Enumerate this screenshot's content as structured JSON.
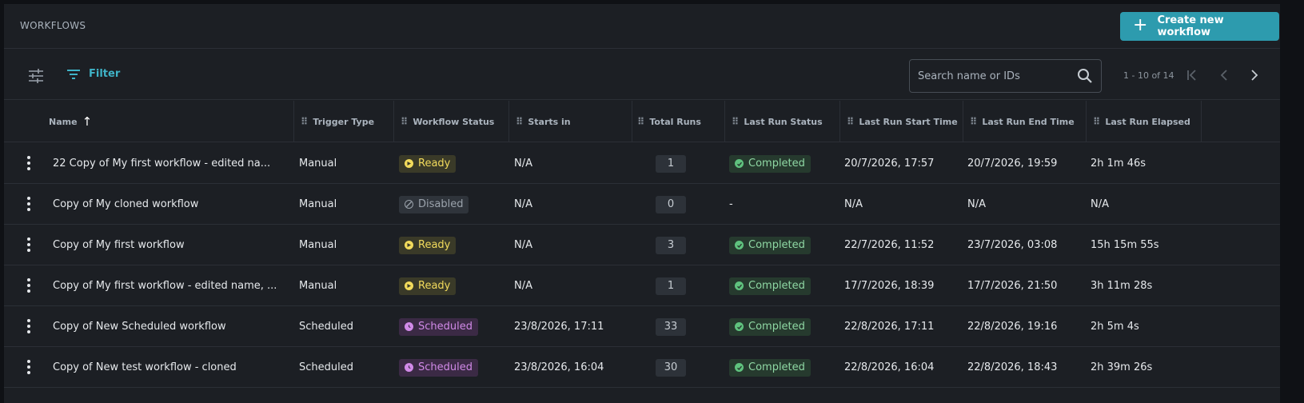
{
  "header": {
    "title": "WORKFLOWS",
    "create_label": "Create new workflow"
  },
  "toolbar": {
    "filter_label": "Filter",
    "search_placeholder": "Search name or IDs",
    "pagination_text": "1 - 10 of 14"
  },
  "columns": [
    "Name",
    "Trigger Type",
    "Workflow Status",
    "Starts in",
    "Total Runs",
    "Last Run Status",
    "Last Run Start Time",
    "Last Run End Time",
    "Last Run Elapsed"
  ],
  "rows": [
    {
      "name": "22 Copy of My first workflow - edited na...",
      "trigger": "Manual",
      "status": "Ready",
      "starts_in": "N/A",
      "total_runs": "1",
      "last_status": "Completed",
      "start_time": "20/7/2026, 17:57",
      "end_time": "20/7/2026, 19:59",
      "elapsed": "2h 1m 46s"
    },
    {
      "name": "Copy of My cloned workflow",
      "trigger": "Manual",
      "status": "Disabled",
      "starts_in": "N/A",
      "total_runs": "0",
      "last_status": "-",
      "start_time": "N/A",
      "end_time": "N/A",
      "elapsed": "N/A"
    },
    {
      "name": "Copy of My first workflow",
      "trigger": "Manual",
      "status": "Ready",
      "starts_in": "N/A",
      "total_runs": "3",
      "last_status": "Completed",
      "start_time": "22/7/2026, 11:52",
      "end_time": "23/7/2026, 03:08",
      "elapsed": "15h 15m 55s"
    },
    {
      "name": "Copy of My first workflow - edited name, ...",
      "trigger": "Manual",
      "status": "Ready",
      "starts_in": "N/A",
      "total_runs": "1",
      "last_status": "Completed",
      "start_time": "17/7/2026, 18:39",
      "end_time": "17/7/2026, 21:50",
      "elapsed": "3h 11m 28s"
    },
    {
      "name": "Copy of New Scheduled workflow",
      "trigger": "Scheduled",
      "status": "Scheduled",
      "starts_in": "23/8/2026, 17:11",
      "total_runs": "33",
      "last_status": "Completed",
      "start_time": "22/8/2026, 17:11",
      "end_time": "22/8/2026, 19:16",
      "elapsed": "2h 5m 4s"
    },
    {
      "name": "Copy of New test workflow - cloned",
      "trigger": "Scheduled",
      "status": "Scheduled",
      "starts_in": "23/8/2026, 16:04",
      "total_runs": "30",
      "last_status": "Completed",
      "start_time": "22/8/2026, 16:04",
      "end_time": "22/8/2026, 18:43",
      "elapsed": "2h 39m 26s"
    }
  ],
  "colors": {
    "accent": "#2d9bae",
    "ready": "#f2db5c",
    "scheduled": "#d18ae8",
    "completed": "#5fc27e",
    "disabled": "#9ba3ac"
  }
}
